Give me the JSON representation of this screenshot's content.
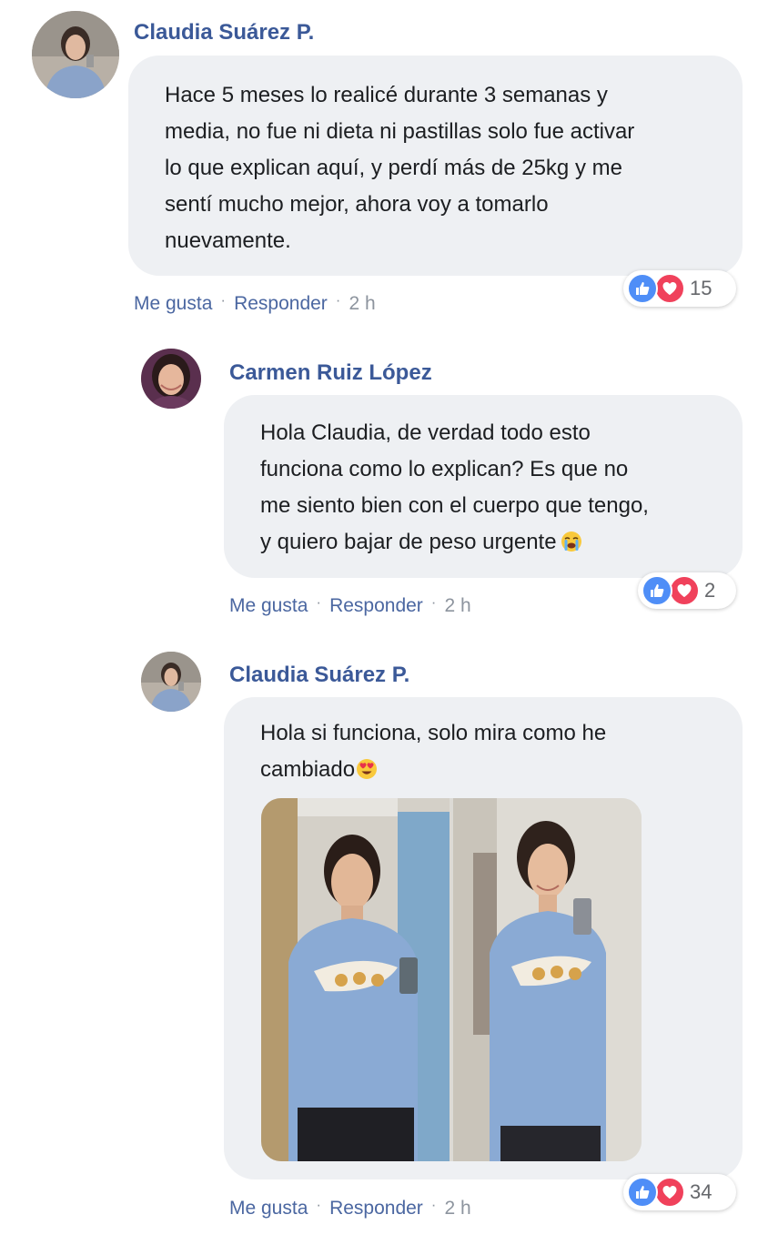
{
  "comments": [
    {
      "author": "Claudia Suárez P.",
      "lines": [
        "Hace 5 meses lo realicé durante 3 semanas y",
        "media, no fue ni dieta ni pastillas solo fue activar",
        "lo que explican aquí, y perdí más de 25kg y me",
        "sentí mucho mejor, ahora voy a tomarlo",
        "nuevamente."
      ],
      "like_label": "Me gusta",
      "reply_label": "Responder",
      "time": "2 h",
      "reaction_count": "15"
    },
    {
      "author": "Carmen Ruiz López",
      "lines": [
        "Hola Claudia, de verdad todo esto",
        "funciona como lo explican? Es que no",
        "me siento bien con el cuerpo que tengo,",
        "y quiero bajar de peso urgente"
      ],
      "emoji": "loudly-crying-face",
      "like_label": "Me gusta",
      "reply_label": "Responder",
      "time": "2 h",
      "reaction_count": "2"
    },
    {
      "author": "Claudia Suárez P.",
      "lines": [
        "Hola si funciona, solo mira como he",
        "cambiado"
      ],
      "emoji": "heart-eyes-face",
      "photos": [
        "before-photo",
        "after-photo"
      ],
      "like_label": "Me gusta",
      "reply_label": "Responder",
      "time": "2 h",
      "reaction_count": "34"
    }
  ],
  "colors": {
    "author": "#3b5998",
    "bubble": "#eef0f3",
    "like": "#4f8ef7",
    "love": "#f0415b"
  },
  "icons": {
    "like": "thumbs-up-icon",
    "love": "heart-icon"
  }
}
